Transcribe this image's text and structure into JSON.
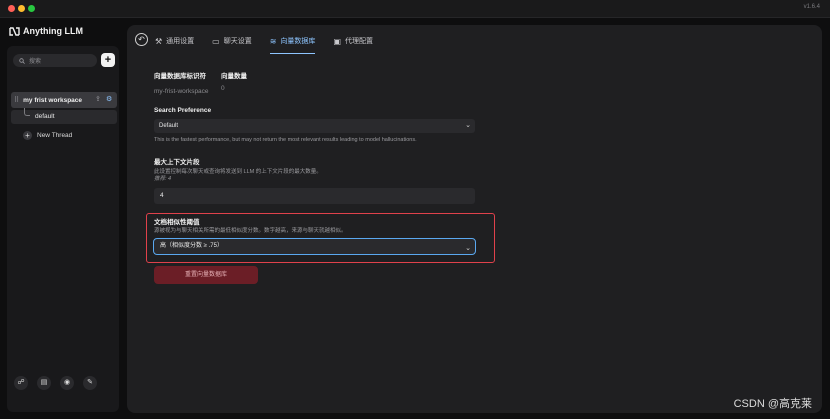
{
  "app": {
    "name": "Anything LLM",
    "version": "v1.6.4"
  },
  "colors": {
    "accent": "#8ec5ff",
    "danger_border": "#e0414b",
    "danger_button": "#6b1e26"
  },
  "sidebar": {
    "search_placeholder": "搜索",
    "new_workspace_label": "+",
    "workspace": {
      "name": "my frist workspace"
    },
    "threads": [
      {
        "name": "default"
      }
    ],
    "new_thread_label": "New Thread",
    "footer_icons": [
      "community-icon",
      "docs-icon",
      "discord-icon",
      "settings-wrench-icon"
    ]
  },
  "tabs": [
    {
      "label": "通用设置",
      "icon": "wrench-icon",
      "active": false
    },
    {
      "label": "聊天设置",
      "icon": "chat-icon",
      "active": false
    },
    {
      "label": "向量数据库",
      "icon": "database-icon",
      "active": true
    },
    {
      "label": "代理配置",
      "icon": "agent-icon",
      "active": false
    }
  ],
  "vector": {
    "id_label": "向量数据库标识符",
    "count_label": "向量数量",
    "id_value": "my-frist-workspace",
    "count_value": "0"
  },
  "search_pref": {
    "label": "Search Preference",
    "value": "Default",
    "description": "This is the fastest performance, but may not return the most relevant results leading to model hallucinations."
  },
  "max_context": {
    "label": "最大上下文片段",
    "description": "此设置控制每次聊天或查询将发送到 LLM 的上下文片段的最大数量。",
    "hint": "推荐: 4",
    "value": "4"
  },
  "similarity": {
    "label": "文档相似性阈值",
    "description": "源被视为与聊天相关所需的最低相似度分数。数字越高，来源与聊天就越相似。",
    "value": "高（相似度分数 ≥ .75）"
  },
  "reset_button": "重置向量数据库",
  "watermark": "CSDN @高克莱"
}
